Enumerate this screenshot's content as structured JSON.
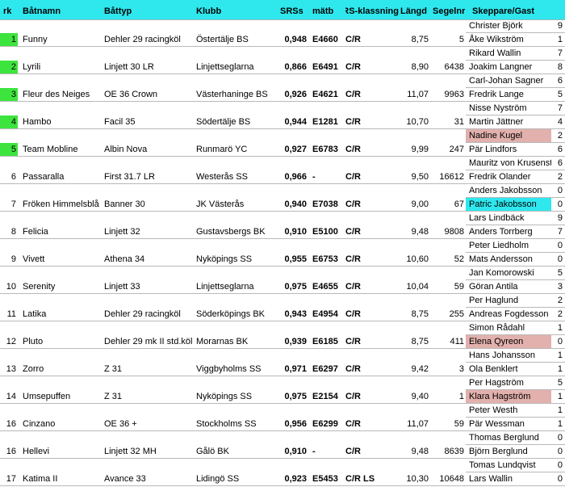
{
  "headers": {
    "rk": "rk",
    "boat": "Båtnamn",
    "type": "Båttyp",
    "club": "Klubb",
    "srs": "SRSs",
    "matb": "mätb",
    "klass": "SRS-klassning",
    "lang": "Längd",
    "segel": "Segelnr",
    "crew": "Skeppare/Gast"
  },
  "rows": [
    {
      "rk": "1",
      "boat": "Funny",
      "type": "Dehler 29 racingköl",
      "club": "Östertälje BS",
      "srs": "0,948",
      "matb": "E4660",
      "klass": "C/R",
      "lang": "8,75",
      "segel": "5",
      "crew1": "Christer Björk",
      "n1": "9",
      "crew2": "Åke Wikström",
      "n2": "1",
      "hl": true,
      "c1": "",
      "c2": ""
    },
    {
      "rk": "2",
      "boat": "Lyrili",
      "type": "Linjett 30 LR",
      "club": "Linjettseglarna",
      "srs": "0,866",
      "matb": "E6491",
      "klass": "C/R",
      "lang": "8,90",
      "segel": "6438",
      "crew1": "Rikard Wallin",
      "n1": "7",
      "crew2": "Joakim Langner",
      "n2": "8",
      "hl": true,
      "c1": "",
      "c2": ""
    },
    {
      "rk": "3",
      "boat": "Fleur des Neiges",
      "type": "OE 36 Crown",
      "club": "Västerhaninge BS",
      "srs": "0,926",
      "matb": "E4621",
      "klass": "C/R",
      "lang": "11,07",
      "segel": "9963",
      "crew1": "Carl-Johan Sagner",
      "n1": "6",
      "crew2": "Fredrik Lange",
      "n2": "5",
      "hl": true,
      "c1": "",
      "c2": ""
    },
    {
      "rk": "4",
      "boat": "Hambo",
      "type": "Facil 35",
      "club": "Södertälje BS",
      "srs": "0,944",
      "matb": "E1281",
      "klass": "C/R",
      "lang": "10,70",
      "segel": "31",
      "crew1": "Nisse Nyström",
      "n1": "7",
      "crew2": "Martin Jättner",
      "n2": "4",
      "hl": true,
      "c1": "",
      "c2": ""
    },
    {
      "rk": "5",
      "boat": "Team Mobline",
      "type": "Albin Nova",
      "club": "Runmarö YC",
      "srs": "0,927",
      "matb": "E6783",
      "klass": "C/R",
      "lang": "9,99",
      "segel": "247",
      "crew1": "Nadine Kugel",
      "n1": "2",
      "crew2": "Pär Lindfors",
      "n2": "6",
      "hl": true,
      "c1": "pink",
      "c2": ""
    },
    {
      "rk": "6",
      "boat": "Passaralla",
      "type": "First 31.7 LR",
      "club": "Westerås SS",
      "srs": "0,966",
      "matb": "-",
      "klass": "C/R",
      "lang": "9,50",
      "segel": "16612",
      "crew1": "Mauritz von Krusenstjerna",
      "n1": "6",
      "crew2": "Fredrik Olander",
      "n2": "2",
      "hl": false,
      "c1": "",
      "c2": ""
    },
    {
      "rk": "7",
      "boat": "Fröken Himmelsblå",
      "type": "Banner 30",
      "club": "JK Västerås",
      "srs": "0,940",
      "matb": "E7038",
      "klass": "C/R",
      "lang": "9,00",
      "segel": "67",
      "crew1": "Anders Jakobsson",
      "n1": "0",
      "crew2": "Patric Jakobsson",
      "n2": "0",
      "hl": false,
      "c1": "",
      "c2": "cyan"
    },
    {
      "rk": "8",
      "boat": "Felicia",
      "type": "Linjett 32",
      "club": "Gustavsbergs BK",
      "srs": "0,910",
      "matb": "E5100",
      "klass": "C/R",
      "lang": "9,48",
      "segel": "9808",
      "crew1": "Lars Lindbäck",
      "n1": "9",
      "crew2": "Anders Torrberg",
      "n2": "7",
      "hl": false,
      "c1": "",
      "c2": ""
    },
    {
      "rk": "9",
      "boat": "Vivett",
      "type": "Athena 34",
      "club": "Nyköpings SS",
      "srs": "0,955",
      "matb": "E6753",
      "klass": "C/R",
      "lang": "10,60",
      "segel": "52",
      "crew1": "Peter Liedholm",
      "n1": "0",
      "crew2": "Mats Andersson",
      "n2": "0",
      "hl": false,
      "c1": "",
      "c2": ""
    },
    {
      "rk": "10",
      "boat": "Serenity",
      "type": "Linjett 33",
      "club": "Linjettseglarna",
      "srs": "0,975",
      "matb": "E4655",
      "klass": "C/R",
      "lang": "10,04",
      "segel": "59",
      "crew1": "Jan Komorowski",
      "n1": "5",
      "crew2": "Göran Antila",
      "n2": "3",
      "hl": false,
      "c1": "",
      "c2": ""
    },
    {
      "rk": "11",
      "boat": "Latika",
      "type": "Dehler 29 racingköl",
      "club": "Söderköpings BK",
      "srs": "0,943",
      "matb": "E4954",
      "klass": "C/R",
      "lang": "8,75",
      "segel": "255",
      "crew1": "Per Haglund",
      "n1": "2",
      "crew2": "Andreas Fogdesson",
      "n2": "2",
      "hl": false,
      "c1": "",
      "c2": ""
    },
    {
      "rk": "12",
      "boat": "Pluto",
      "type": "Dehler 29 mk II std.köl",
      "club": "Morarnas BK",
      "srs": "0,939",
      "matb": "E6185",
      "klass": "C/R",
      "lang": "8,75",
      "segel": "411",
      "crew1": "Simon Rådahl",
      "n1": "1",
      "crew2": "Elena Qyreon",
      "n2": "0",
      "hl": false,
      "c1": "",
      "c2": "pink"
    },
    {
      "rk": "13",
      "boat": "Zorro",
      "type": "Z 31",
      "club": "Viggbyholms SS",
      "srs": "0,971",
      "matb": "E6297",
      "klass": "C/R",
      "lang": "9,42",
      "segel": "3",
      "crew1": "Hans Johansson",
      "n1": "1",
      "crew2": "Ola Benklert",
      "n2": "1",
      "hl": false,
      "c1": "",
      "c2": ""
    },
    {
      "rk": "14",
      "boat": "Umsepuffen",
      "type": "Z 31",
      "club": "Nyköpings SS",
      "srs": "0,975",
      "matb": "E2154",
      "klass": "C/R",
      "lang": "9,40",
      "segel": "1",
      "crew1": "Per Hagström",
      "n1": "5",
      "crew2": "Klara Hagström",
      "n2": "1",
      "hl": false,
      "c1": "",
      "c2": "pink"
    },
    {
      "rk": "16",
      "boat": "Cinzano",
      "type": "OE 36 +",
      "club": "Stockholms SS",
      "srs": "0,956",
      "matb": "E6299",
      "klass": "C/R",
      "lang": "11,07",
      "segel": "59",
      "crew1": "Peter Westh",
      "n1": "1",
      "crew2": "Pär Wessman",
      "n2": "1",
      "hl": false,
      "c1": "",
      "c2": ""
    },
    {
      "rk": "16",
      "boat": "Hellevi",
      "type": "Linjett 32 MH",
      "club": "Gålö BK",
      "srs": "0,910",
      "matb": "-",
      "klass": "C/R",
      "lang": "9,48",
      "segel": "8639",
      "crew1": "Thomas Berglund",
      "n1": "0",
      "crew2": "Björn Berglund",
      "n2": "0",
      "hl": false,
      "c1": "",
      "c2": ""
    },
    {
      "rk": "17",
      "boat": "Katima II",
      "type": "Avance 33",
      "club": "Lidingö SS",
      "srs": "0,923",
      "matb": "E5453",
      "klass": "C/R LS",
      "lang": "10,30",
      "segel": "10648",
      "crew1": "Tomas Lundqvist",
      "n1": "0",
      "crew2": "Lars Wallin",
      "n2": "0",
      "hl": false,
      "c1": "",
      "c2": ""
    }
  ]
}
